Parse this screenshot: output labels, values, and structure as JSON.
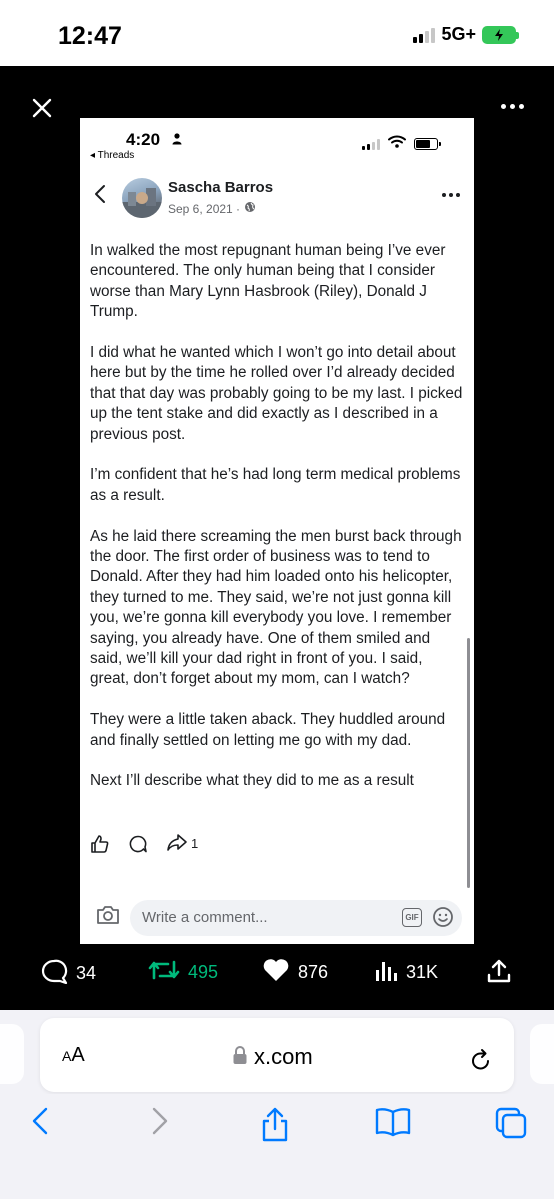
{
  "status_bar": {
    "time": "12:47",
    "network": "5G+"
  },
  "viewer": {
    "close_icon": "close-icon",
    "more_icon": "more-icon"
  },
  "inner_screenshot": {
    "status": {
      "time": "4:20",
      "back_label": "◂ Threads"
    },
    "post": {
      "author": "Sascha Barros",
      "date": "Sep 6, 2021 ·",
      "paragraphs": [
        "In walked the most repugnant human being I’ve ever encountered. The only human being that I consider worse than Mary Lynn Hasbrook (Riley), Donald J Trump.",
        "I did what he wanted which I won’t go into detail about here but by the time he rolled over I’d already decided that that day was probably going to be my last. I picked up the tent stake and did exactly as I described in a previous post.",
        "I’m confident that he’s had long term medical problems as a result.",
        "As he laid there screaming the men burst back through the door. The first order of business was to tend to Donald. After they had him loaded onto his helicopter, they turned to me. They said, we’re not just gonna kill you, we’re gonna kill everybody you love. I remember saying, you already have. One of them smiled and said, we’ll kill your dad right in front of you. I said, great, don’t forget about my mom, can I watch?",
        "They were a little taken aback. They huddled around and finally settled on letting me go with my dad.",
        "Next I’ll describe what they did to me as a result"
      ],
      "share_count": "1"
    },
    "comment": {
      "placeholder": "Write a comment...",
      "gif_label": "GIF"
    }
  },
  "tweet_actions": {
    "replies": "34",
    "retweets": "495",
    "likes": "876",
    "views": "31K"
  },
  "safari": {
    "text_size_label_big": "A",
    "text_size_label_small": "A",
    "url": "x.com"
  },
  "colors": {
    "retweet_green": "#00ba7c",
    "battery_green": "#34c759",
    "safari_blue": "#007aff"
  }
}
